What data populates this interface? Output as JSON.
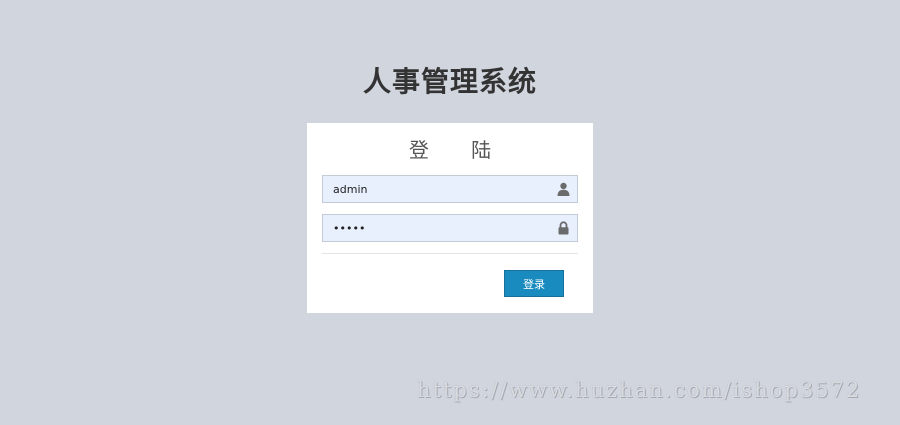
{
  "page": {
    "title": "人事管理系统",
    "background_color": "#d1d5de"
  },
  "login_panel": {
    "heading": "登 陆",
    "username": {
      "value": "admin",
      "icon": "user-icon"
    },
    "password": {
      "value": "admin",
      "icon": "lock-icon"
    },
    "submit_label": "登录",
    "button_color": "#1a8bbf"
  },
  "watermark": {
    "text": "https://www.huzhan.com/ishop3572"
  }
}
